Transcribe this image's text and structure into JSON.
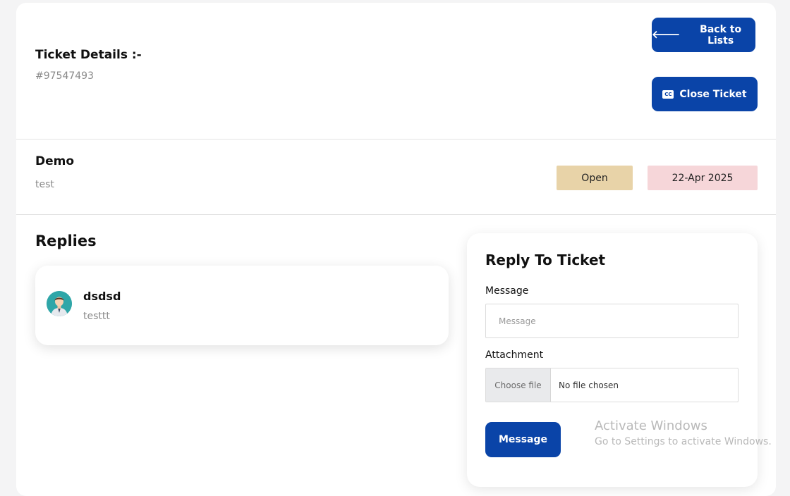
{
  "header": {
    "title": "Ticket Details :-",
    "ticket_id": "#97547493",
    "back_label": "Back to Lists",
    "close_label": "Close Ticket",
    "close_icon_text": "CC"
  },
  "ticket": {
    "subject": "Demo",
    "description": "test",
    "status": "Open",
    "date": "22-Apr 2025"
  },
  "replies": {
    "title": "Replies",
    "items": [
      {
        "name": "dsdsd",
        "text": "testtt"
      }
    ]
  },
  "reply_form": {
    "title": "Reply To Ticket",
    "message_label": "Message",
    "message_placeholder": "Message",
    "attachment_label": "Attachment",
    "choose_file": "Choose file",
    "no_file": "No file chosen",
    "submit_label": "Message"
  },
  "watermark": {
    "title": "Activate Windows",
    "subtitle": "Go to Settings to activate Windows."
  },
  "colors": {
    "primary": "#0a44a8",
    "status_badge": "#e8d3a8",
    "date_badge": "#f6d6d9",
    "background": "#f4f4f5"
  }
}
